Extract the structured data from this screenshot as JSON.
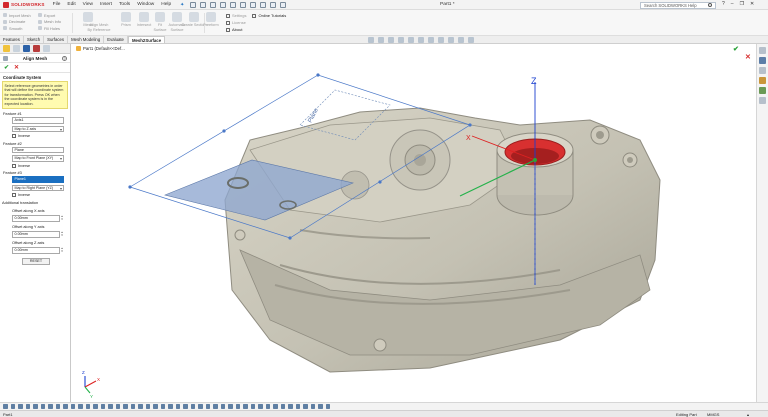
{
  "titlebar": {
    "logo": "SOLIDWORKS",
    "menu": [
      "File",
      "Edit",
      "View",
      "Insert",
      "Tools",
      "Window",
      "Help"
    ],
    "document_title": "Part1 *",
    "search_placeholder": "Search SOLIDWORKS Help",
    "help_label": "?"
  },
  "command_manager": {
    "import_group": [
      "Import Mesh",
      "Decimate",
      "Smooth"
    ],
    "export_group": [
      "Export",
      "Mesh Info",
      "Fill Holes"
    ],
    "align_big": [
      "Mesh",
      "Align Mesh",
      "By Reference"
    ],
    "big_buttons": [
      [
        "Prism"
      ],
      [
        "Intersect"
      ],
      [
        "Fit",
        "Surface"
      ],
      [
        "Automatic",
        "Surface"
      ],
      [
        "Create Section"
      ],
      [
        "Freeform"
      ]
    ],
    "settings_group": [
      "Settings",
      "License",
      "About"
    ],
    "online_tutorials": "Online Tutorials"
  },
  "tabs": [
    "Features",
    "Sketch",
    "Surfaces",
    "Mesh Modeling",
    "Evaluate",
    "Mesh2Surface"
  ],
  "active_tab": "Mesh2Surface",
  "breadcrumb": "Part1 (Default<<Def...",
  "property_manager": {
    "title": "Align Mesh",
    "section": "Coordinate System",
    "note": "Select reference geometries in order that will define the coordinate system for transformation. Press OK when the coordinate system is in the expected location.",
    "features": [
      {
        "label": "Feature #1",
        "value": "Axis1",
        "map": "Map to Z axis",
        "inverse": "Inverse"
      },
      {
        "label": "Feature #2",
        "value": "Plane",
        "map": "Map to Front Plane (XY)",
        "inverse": "Inverse"
      },
      {
        "label": "Feature #3",
        "value": "Plane1",
        "map": "Map to Right Plane (YZ)",
        "inverse": "Inverse"
      }
    ],
    "additional_translation": "Additional translation",
    "offsets": [
      {
        "label": "Offset along X axis",
        "value": "0.00mm"
      },
      {
        "label": "Offset along Y axis",
        "value": "0.00mm"
      },
      {
        "label": "Offset along Z axis",
        "value": "0.00mm"
      }
    ],
    "reset_label": "RESET"
  },
  "viewport": {
    "plane_label": "Plane",
    "axis_z": "Z",
    "axis_x": "X",
    "triad": {
      "x": "X",
      "y": "Y",
      "z": "Z"
    }
  },
  "statusbar": {
    "left": "Part1",
    "editing": "Editing Part",
    "units": "MMGS"
  },
  "colors": {
    "accent": "#1a6fc1",
    "brand": "#d2262b",
    "ok": "#2ba339",
    "cancel": "#d62b2b",
    "note_bg": "#fffbb0"
  }
}
